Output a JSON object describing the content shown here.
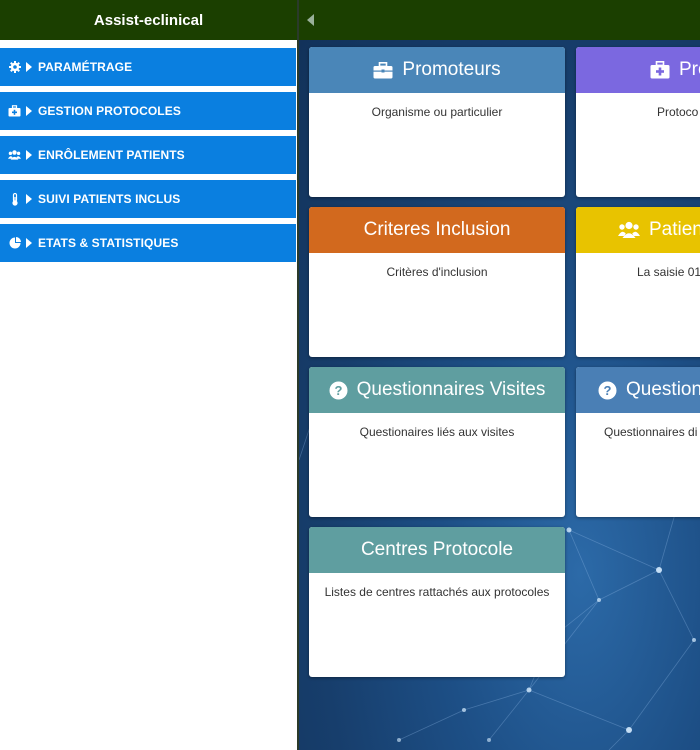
{
  "app": {
    "title": "Assist-eclinical"
  },
  "menu": [
    {
      "label": "PARAMÉTRAGE",
      "icon": "gear-icon"
    },
    {
      "label": "GESTION PROTOCOLES",
      "icon": "medical-kit-icon"
    },
    {
      "label": "ENRÔLEMENT PATIENTS",
      "icon": "users-icon"
    },
    {
      "label": "SUIVI PATIENTS INCLUS",
      "icon": "thermometer-icon"
    },
    {
      "label": "ETATS & STATISTIQUES",
      "icon": "pie-chart-icon"
    }
  ],
  "cards": [
    {
      "title": "Promoteurs",
      "subtitle": "Organisme ou particulier",
      "color": "#4a86b8",
      "icon": "briefcase-icon"
    },
    {
      "title": "Pro",
      "subtitle": "Protoco",
      "color": "#7b68e0",
      "icon": "medical-kit-icon"
    },
    {
      "title": "Criteres Inclusion",
      "subtitle": "Critères d'inclusion",
      "color": "#d2691e",
      "icon": ""
    },
    {
      "title": "Patien",
      "subtitle": "La saisie 01",
      "color": "#e8c300",
      "icon": "users-icon"
    },
    {
      "title": "Questionnaires Visites",
      "subtitle": "Questionaires liés aux visites",
      "color": "#5f9ea0",
      "icon": "question-circle-icon"
    },
    {
      "title": "Question",
      "subtitle": "Questionnaires di",
      "color": "#4a7fb5",
      "icon": "question-circle-icon"
    },
    {
      "title": "Centres Protocole",
      "subtitle": "Listes de centres rattachés aux protocoles",
      "color": "#5f9ea0",
      "icon": ""
    }
  ]
}
